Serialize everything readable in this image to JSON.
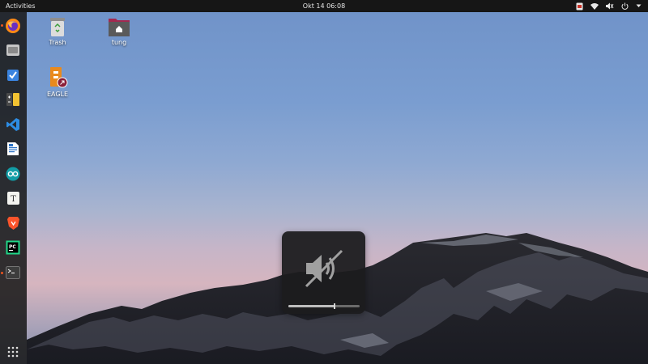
{
  "topbar": {
    "activities": "Activities",
    "clock": "Okt 14  06:08",
    "tray_icons": [
      "app-indicator-icon",
      "network-wired-icon",
      "volume-muted-icon",
      "power-icon",
      "chevron-down-icon"
    ]
  },
  "dock": {
    "apps": [
      {
        "name": "Firefox",
        "icon": "firefox-icon",
        "running": true
      },
      {
        "name": "Files",
        "icon": "files-icon",
        "running": false
      },
      {
        "name": "Tasks",
        "icon": "tasks-icon",
        "running": false
      },
      {
        "name": "Calculator",
        "icon": "calculator-icon",
        "running": false
      },
      {
        "name": "Visual Studio Code",
        "icon": "vscode-icon",
        "running": false
      },
      {
        "name": "LibreOffice Writer",
        "icon": "writer-icon",
        "running": false
      },
      {
        "name": "Arduino IDE",
        "icon": "arduino-icon",
        "running": false
      },
      {
        "name": "Text Editor",
        "icon": "text-editor-icon",
        "running": false
      },
      {
        "name": "Brave",
        "icon": "brave-icon",
        "running": false
      },
      {
        "name": "PyCharm",
        "icon": "pycharm-icon",
        "running": false
      },
      {
        "name": "Terminal",
        "icon": "terminal-icon",
        "running": true
      }
    ],
    "show_apps_icon": "app-grid-icon"
  },
  "desktop": {
    "icons": [
      {
        "label": "Trash",
        "icon": "trash-icon"
      },
      {
        "label": "tung",
        "icon": "home-folder-icon"
      },
      {
        "label": "EAGLE",
        "icon": "eagle-icon"
      }
    ]
  },
  "osd": {
    "icon": "volume-muted-icon",
    "level": 0.65
  },
  "colors": {
    "accent": "#e95420",
    "topbar": "#161616",
    "dock": "#1a1a1a"
  }
}
